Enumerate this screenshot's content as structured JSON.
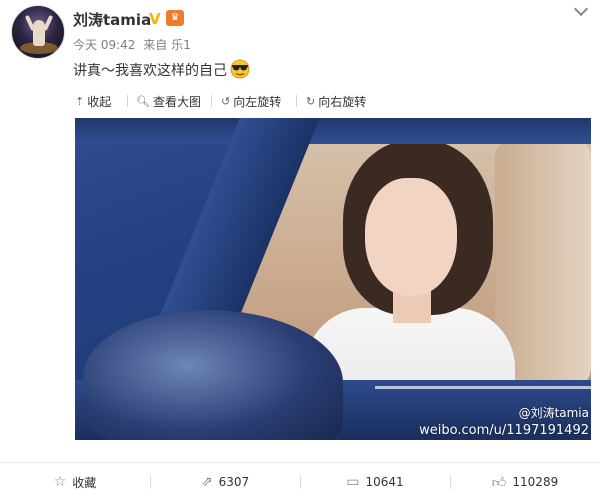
{
  "post": {
    "author": "刘涛tamia",
    "verified_mark": "V",
    "time": "今天 09:42",
    "source_prefix": "来自",
    "source": "乐1",
    "text": "讲真～我喜欢这样的自己"
  },
  "toolbar": {
    "collapse": "收起",
    "view_large": "查看大图",
    "rotate_left": "向左旋转",
    "rotate_right": "向右旋转"
  },
  "image": {
    "watermark_handle": "@刘涛tamia",
    "watermark_url": "weibo.com/u/1197191492"
  },
  "actions": {
    "favorite": "收藏",
    "reposts": "6307",
    "comments": "10641",
    "likes": "110289"
  },
  "icons": {
    "collapse": "arrow-up-icon",
    "view_large": "magnifier-icon",
    "rotate_left": "rotate-left-icon",
    "rotate_right": "rotate-right-icon",
    "favorite": "star-icon",
    "repost": "share-icon",
    "comment": "comment-icon",
    "like": "thumbs-up-icon"
  }
}
